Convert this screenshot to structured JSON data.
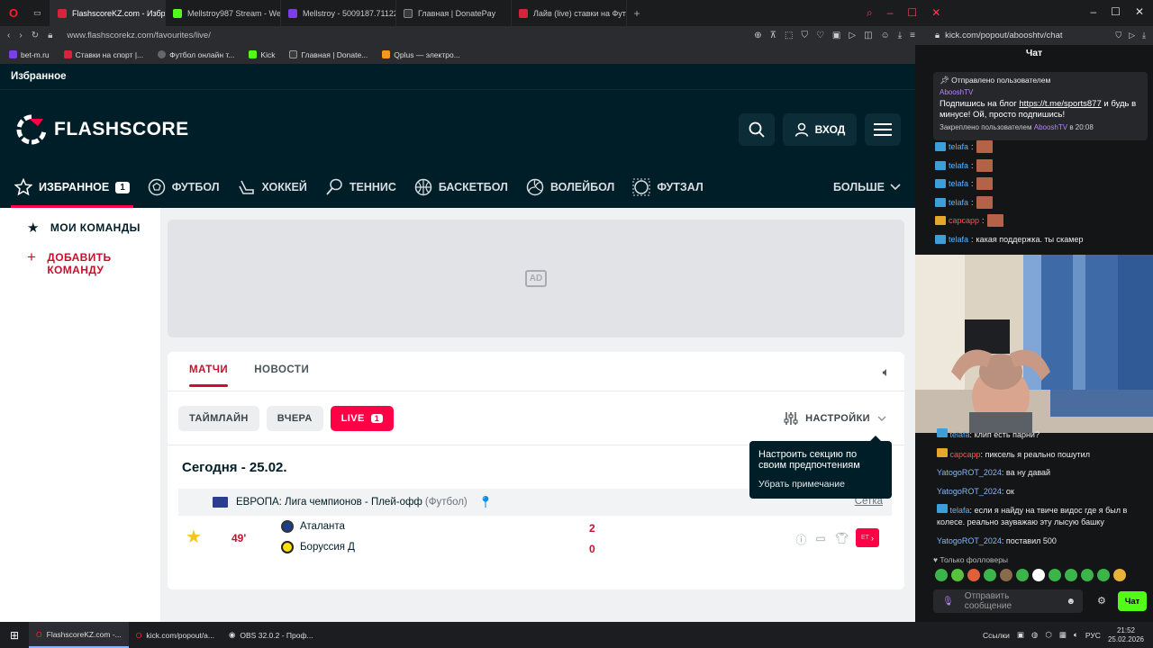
{
  "browser": {
    "tabs": [
      {
        "label": "FlashscoreKZ.com - Избр",
        "icon": "flashscore",
        "active": true
      },
      {
        "label": "Mellstroy987 Stream - We",
        "icon": "kick"
      },
      {
        "label": "Mellstroy - 5009187.71122",
        "icon": "mellstroy"
      },
      {
        "label": "Главная | DonatePay",
        "icon": "donatepay"
      },
      {
        "label": "Лайв (live) ставки на Фут",
        "icon": "fonbet"
      }
    ],
    "url": "www.flashscorekz.com/favourites/live/",
    "bookmarks": [
      "bet-m.ru",
      "Ставки на спорт |...",
      "Футбол онлайн т...",
      "Kick",
      "Главная | Donate...",
      "Qplus — электро..."
    ]
  },
  "flashscore": {
    "section_title": "Избранное",
    "logo_text": "FLASHSCORE",
    "login_label": "ВХОД",
    "nav": [
      {
        "label": "ИЗБРАННОЕ",
        "badge": "1",
        "icon": "star-icon",
        "active": true
      },
      {
        "label": "ФУТБОЛ",
        "icon": "football-icon"
      },
      {
        "label": "ХОККЕЙ",
        "icon": "hockey-icon"
      },
      {
        "label": "ТЕННИС",
        "icon": "tennis-icon"
      },
      {
        "label": "БАСКЕТБОЛ",
        "icon": "basketball-icon"
      },
      {
        "label": "ВОЛЕЙБОЛ",
        "icon": "volleyball-icon"
      },
      {
        "label": "ФУТЗАЛ",
        "icon": "futsal-icon"
      }
    ],
    "nav_more": "БОЛЬШЕ",
    "sidebar": {
      "my_teams": "МОИ КОМАНДЫ",
      "add_team": "ДОБАВИТЬ КОМАНДУ"
    },
    "ad_label": "AD",
    "tabs": [
      "МАТЧИ",
      "НОВОСТИ"
    ],
    "filters": {
      "timeline": "ТАЙМЛАЙН",
      "yesterday": "ВЧЕРА",
      "live": "LIVE",
      "live_count": "1",
      "settings": "НАСТРОЙКИ"
    },
    "date_heading": "Сегодня - 25.02.",
    "league": {
      "name": "ЕВРОПА: Лига чемпионов - Плей-офф",
      "sport": "(Футбол)",
      "bracket": "Сетка"
    },
    "match": {
      "minute": "49'",
      "home": {
        "name": "Аталанта",
        "score": "2"
      },
      "away": {
        "name": "Боруссия Д",
        "score": "0"
      },
      "bet_label": "ET"
    },
    "tooltip": {
      "text": "Настроить секцию по своим предпочтениям",
      "dismiss": "Убрать примечание"
    }
  },
  "chat": {
    "url": "kick.com/popout/abooshtv/chat",
    "title": "Чат",
    "pinned": {
      "header": "Отправлено пользователем",
      "author": "AbooshTV",
      "message_prefix": "Подпишись на блог ",
      "link": "https://t.me/sports877",
      "message_suffix": " и будь в минусе! Ой, просто подпишись!",
      "footer_prefix": "Закреплено пользователем",
      "footer_user": "AbooshTV",
      "footer_time": "в 20:08"
    },
    "top_messages": [
      {
        "user": "telafa",
        "text": ""
      },
      {
        "user": "telafa",
        "text": ""
      },
      {
        "user": "telafa",
        "text": ""
      },
      {
        "user": "telafa",
        "text": ""
      },
      {
        "user": "capcapp",
        "text": ""
      },
      {
        "user": "telafa",
        "text": "какая поддержка. ты скамер"
      }
    ],
    "bottom_messages": [
      {
        "user": "telafa",
        "text": "клип есть парни?"
      },
      {
        "user": "capcapp",
        "text": "пиксель я реально пошутил"
      },
      {
        "user": "YatogoROT_2024",
        "text": "ва ну давай"
      },
      {
        "user": "YatogoROT_2024",
        "text": "ок"
      },
      {
        "user": "telafa",
        "text": "если я найду на твиче видос где я был в колесе. реально зауважаю эту лысую башку"
      },
      {
        "user": "YatogoROT_2024",
        "text": "поставил 500"
      }
    ],
    "followers_label": "Только фолловеры",
    "input_placeholder": "Отправить сообщение",
    "send_label": "Чат"
  },
  "taskbar": {
    "items": [
      "FlashscoreKZ.com -...",
      "kick.com/popout/a...",
      "OBS 32.0.2 - Проф..."
    ],
    "tray_links": "Ссылки",
    "lang": "РУС",
    "time": "21:52",
    "date": "25.02.2026"
  }
}
